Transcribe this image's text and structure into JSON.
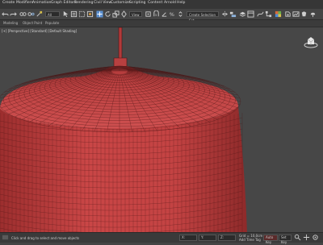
{
  "menu": [
    "Create",
    "Modifiers",
    "Animation",
    "Graph Editors",
    "Rendering",
    "Civil View",
    "Customize",
    "Scripting",
    "Content",
    "Arnold",
    "Help"
  ],
  "toolbar": {
    "view_dropdown": "View",
    "selection_set": "Create Selection Set"
  },
  "ribbon": [
    "Modeling",
    "Object Paint",
    "Populate"
  ],
  "viewport": {
    "label": "[+] [Perspective] [Standard] [Default Shading]",
    "object_color": "#c94646",
    "background": "#474747"
  },
  "statusbar": {
    "x_field": "X:",
    "y_field": "Y:",
    "z_field": "Z:",
    "grid": "Grid = 10,0cm",
    "auto_key": "Auto Key",
    "set_key": "Set Key",
    "add_time_tag": "Add Time Tag",
    "script_label": "Click and drag to select and move objects"
  },
  "icons": [
    "undo-icon",
    "redo-icon",
    "link-icon",
    "unlink-icon",
    "bind-icon",
    "select-icon",
    "select-by-name-icon",
    "rect-select-icon",
    "window-crossing-icon",
    "move-icon",
    "rotate-icon",
    "scale-icon",
    "snap-icon",
    "angle-snap-icon",
    "percent-snap-icon",
    "mirror-icon",
    "align-icon",
    "layer-icon",
    "curve-editor-icon",
    "schematic-icon",
    "material-editor-icon",
    "render-setup-icon",
    "render-frame-icon",
    "render-icon"
  ]
}
